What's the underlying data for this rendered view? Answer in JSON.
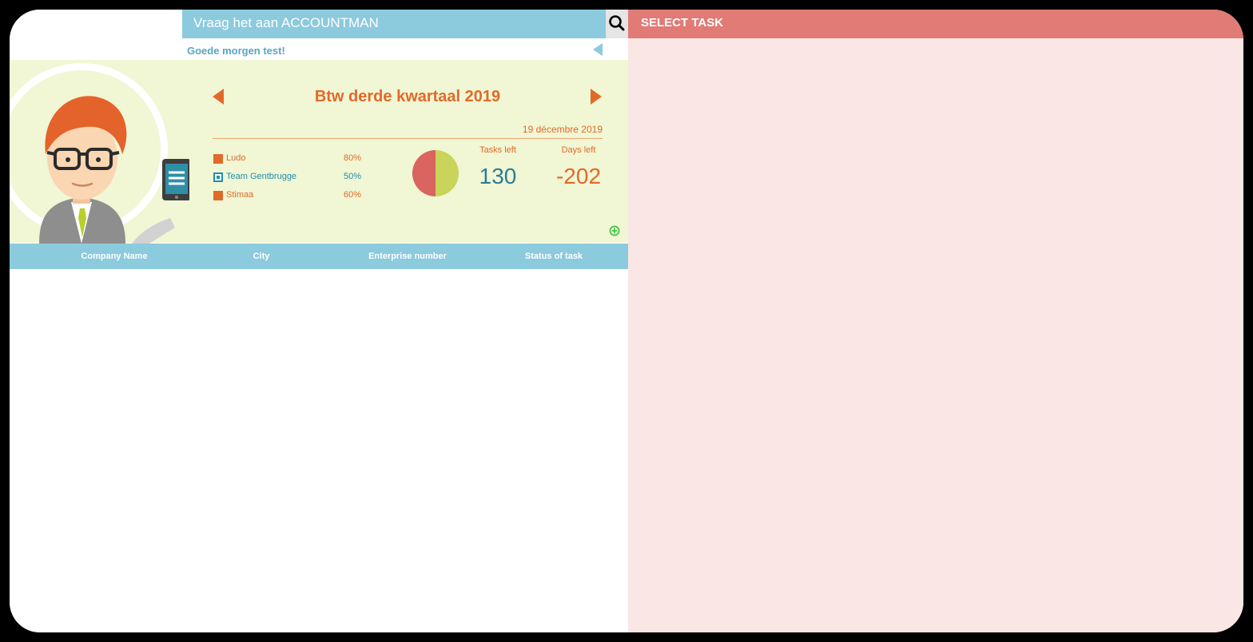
{
  "search": {
    "placeholder": "Vraag het aan ACCOUNTMAN"
  },
  "greeting": "Goede morgen test!",
  "task": {
    "title": "Btw derde kwartaal 2019",
    "date": "19 décembre 2019",
    "tasks_left_label": "Tasks left",
    "tasks_left_value": "130",
    "days_left_label": "Days left",
    "days_left_value": "-202"
  },
  "teams": [
    {
      "name": "Ludo",
      "percent": "80%",
      "color": "#e06a2a",
      "selected": false
    },
    {
      "name": "Team Gentbrugge",
      "percent": "50%",
      "color": "#1f8fb0",
      "selected": true
    },
    {
      "name": "Stimaa",
      "percent": "60%",
      "color": "#e06a2a",
      "selected": false
    }
  ],
  "pie": {
    "slices": [
      {
        "value": 50,
        "color": "#d96460"
      },
      {
        "value": 50,
        "color": "#c9d45a"
      }
    ]
  },
  "table": {
    "columns": [
      "Company Name",
      "City",
      "Enterprise number",
      "Status of task"
    ]
  },
  "right_panel": {
    "title": "SELECT TASK"
  },
  "icons": {
    "search": "search-icon",
    "collapse": "triangle-left-icon",
    "prev": "triangle-left-icon",
    "next": "triangle-right-icon",
    "add": "plus-circle-icon",
    "avatar": "accountant-avatar-icon"
  },
  "colors": {
    "accent_blue": "#8ccadd",
    "accent_orange": "#e06a2a",
    "accent_red": "#e07b76",
    "panel_bg": "#f1f6d4"
  }
}
